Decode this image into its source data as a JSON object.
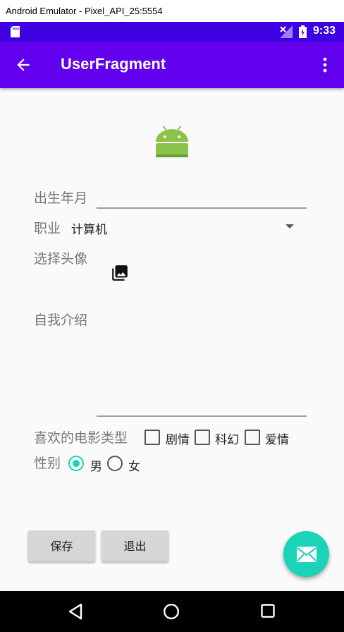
{
  "window": {
    "title": "Android Emulator - Pixel_API_25:5554"
  },
  "status_bar": {
    "time": "9:33"
  },
  "app_bar": {
    "title": "UserFragment",
    "back_icon": "arrow-back-icon",
    "menu_icon": "more-vert-icon"
  },
  "form": {
    "birth_label": "出生年月",
    "birth_value": "",
    "job_label": "职业",
    "job_selected": "计算机",
    "avatar_label": "选择头像",
    "avatar_icon": "photo-library-icon",
    "intro_label": "自我介绍",
    "intro_value": "",
    "movie_label": "喜欢的电影类型",
    "movie_options": [
      "剧情",
      "科幻",
      "爱情"
    ],
    "gender_label": "性别",
    "gender_options": [
      "男",
      "女"
    ],
    "gender_selected": "男"
  },
  "buttons": {
    "save": "保存",
    "exit": "退出"
  },
  "fab": {
    "icon": "email-icon",
    "color": "#1ad3b9"
  },
  "colors": {
    "status_bar": "#3d00e0",
    "app_bar": "#6200ee",
    "accent": "#1ad3b9"
  }
}
